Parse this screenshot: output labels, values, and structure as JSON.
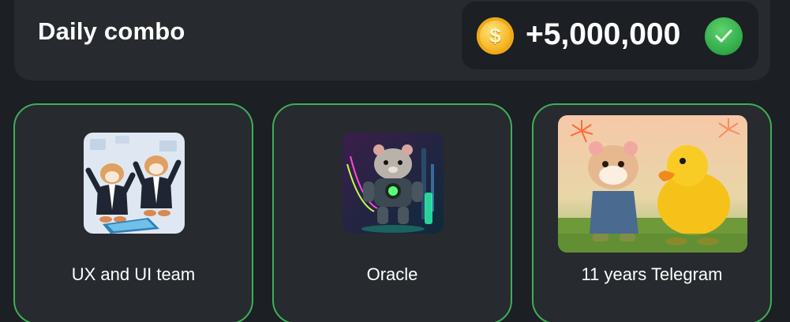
{
  "header": {
    "title": "Daily combo",
    "reward_amount": "+5,000,000",
    "coin_icon": "coin-icon",
    "coin_symbol": "$",
    "status_icon": "checkmark-icon"
  },
  "cards": [
    {
      "label": "UX and UI team",
      "image": "hamsters-in-suits-illustration"
    },
    {
      "label": "Oracle",
      "image": "robot-hamster-illustration"
    },
    {
      "label": "11 years Telegram",
      "image": "hamster-and-duck-illustration"
    }
  ],
  "colors": {
    "background": "#1c1f24",
    "panel": "#272a2f",
    "card_border": "#3fae57",
    "coin": "#f7b92a",
    "check": "#2fa847"
  }
}
